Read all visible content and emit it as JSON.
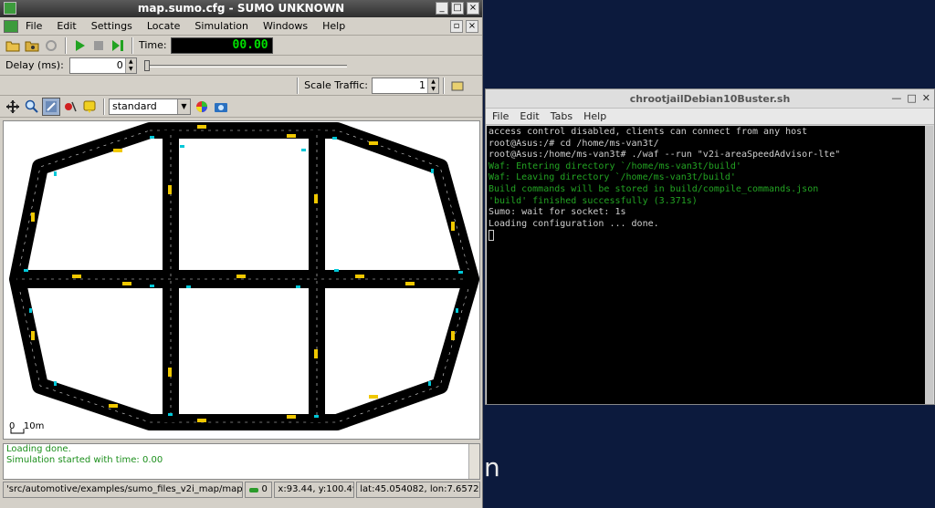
{
  "sumo": {
    "title": "map.sumo.cfg - SUMO UNKNOWN",
    "menu": [
      "File",
      "Edit",
      "Settings",
      "Locate",
      "Simulation",
      "Windows",
      "Help"
    ],
    "time_label": "Time:",
    "time_value": "00.00",
    "delay_label": "Delay (ms):",
    "delay_value": "0",
    "scale_traffic_label": "Scale Traffic:",
    "scale_traffic_value": "1",
    "scheme": "standard",
    "scale_bar": {
      "zero": "0",
      "length": "10m"
    },
    "messages": [
      "Loading done.",
      "Simulation started with time: 0.00"
    ],
    "status": {
      "path": "'src/automotive/examples/sumo_files_v2i_map/map.su",
      "vehicles": "0",
      "xy": "x:93.44, y:100.49",
      "latlon": "lat:45.054082, lon:7.657238"
    }
  },
  "terminal": {
    "title": "chrootjailDebian10Buster.sh",
    "menu": [
      "File",
      "Edit",
      "Tabs",
      "Help"
    ],
    "lines": [
      {
        "t": "access control disabled, clients can connect from any host",
        "c": "w"
      },
      {
        "t": "root@Asus:/# cd /home/ms-van3t/",
        "c": "w"
      },
      {
        "t": "root@Asus:/home/ms-van3t# ./waf --run \"v2i-areaSpeedAdvisor-lte\"",
        "c": "w"
      },
      {
        "t": "Waf: Entering directory `/home/ms-van3t/build'",
        "c": "g"
      },
      {
        "t": "Waf: Leaving directory `/home/ms-van3t/build'",
        "c": "g"
      },
      {
        "t": "Build commands will be stored in build/compile_commands.json",
        "c": "g"
      },
      {
        "t": "'build' finished successfully (3.371s)",
        "c": "g"
      },
      {
        "t": "Sumo: wait for socket: 1s",
        "c": "w"
      },
      {
        "t": "Loading configuration ... done.",
        "c": "w"
      }
    ]
  },
  "desktop_text": "n"
}
